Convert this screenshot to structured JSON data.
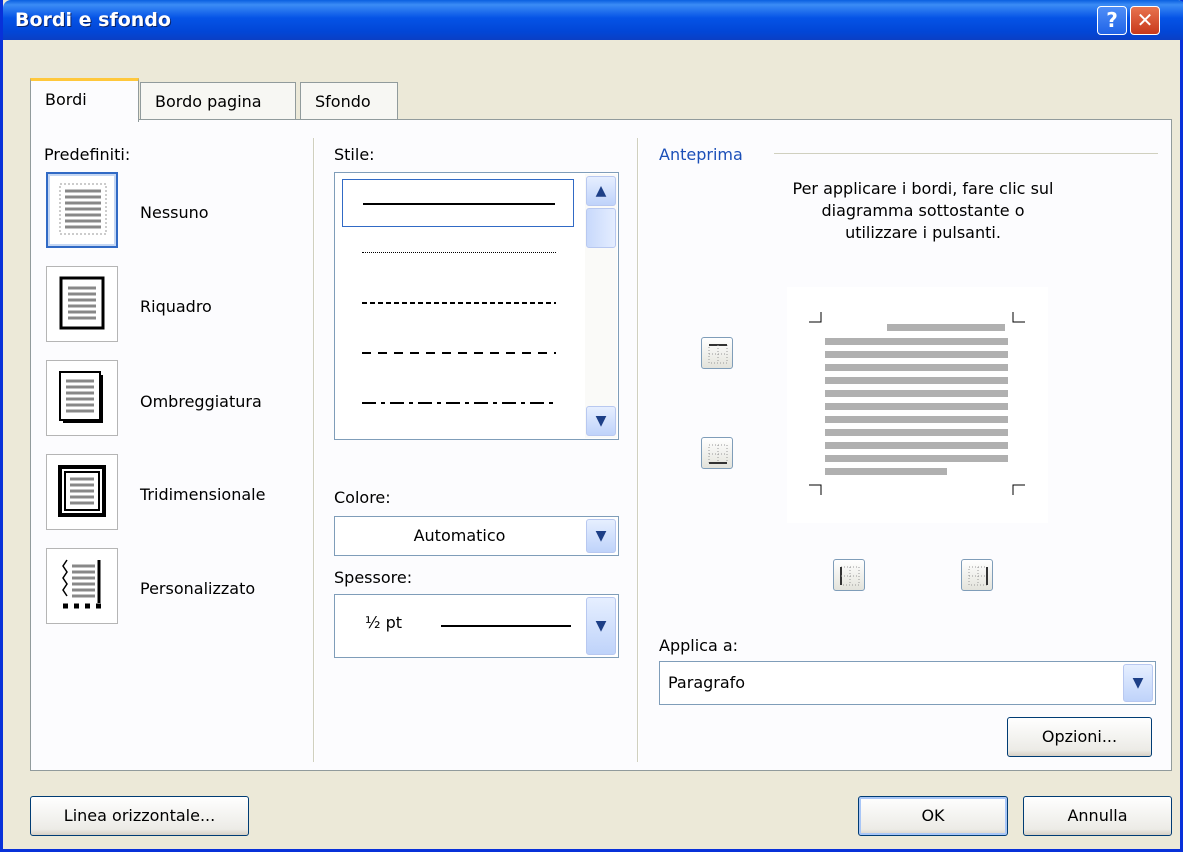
{
  "window": {
    "title": "Bordi e sfondo",
    "help_glyph": "?",
    "close_glyph": "✕"
  },
  "tabs": [
    {
      "label": "Bordi"
    },
    {
      "label": "Bordo pagina"
    },
    {
      "label": "Sfondo"
    }
  ],
  "presets": {
    "label": "Predefiniti:",
    "items": [
      {
        "label": "Nessuno",
        "icon": "none-border-icon"
      },
      {
        "label": "Riquadro",
        "icon": "box-border-icon"
      },
      {
        "label": "Ombreggiatura",
        "icon": "shadow-border-icon"
      },
      {
        "label": "Tridimensionale",
        "icon": "3d-border-icon"
      },
      {
        "label": "Personalizzato",
        "icon": "custom-border-icon"
      }
    ]
  },
  "style": {
    "label": "Stile:",
    "options": [
      "solid",
      "dotted",
      "dashed-small",
      "dashed",
      "dash-dot"
    ],
    "selected": "solid"
  },
  "color": {
    "label": "Colore:",
    "value": "Automatico"
  },
  "width": {
    "label": "Spessore:",
    "value": "½ pt"
  },
  "preview": {
    "title": "Anteprima",
    "instructions": [
      "Per applicare i bordi, fare clic sul",
      "diagramma sottostante o",
      "utilizzare i pulsanti."
    ]
  },
  "apply_to": {
    "label": "Applica a:",
    "value": "Paragrafo"
  },
  "buttons": {
    "options": "Opzioni...",
    "horizontal_line": "Linea orizzontale...",
    "ok": "OK",
    "cancel": "Annulla"
  },
  "colors": {
    "title_bar": "#0553e6",
    "accent": "#316ac5",
    "group_title": "#1b4fb8"
  }
}
